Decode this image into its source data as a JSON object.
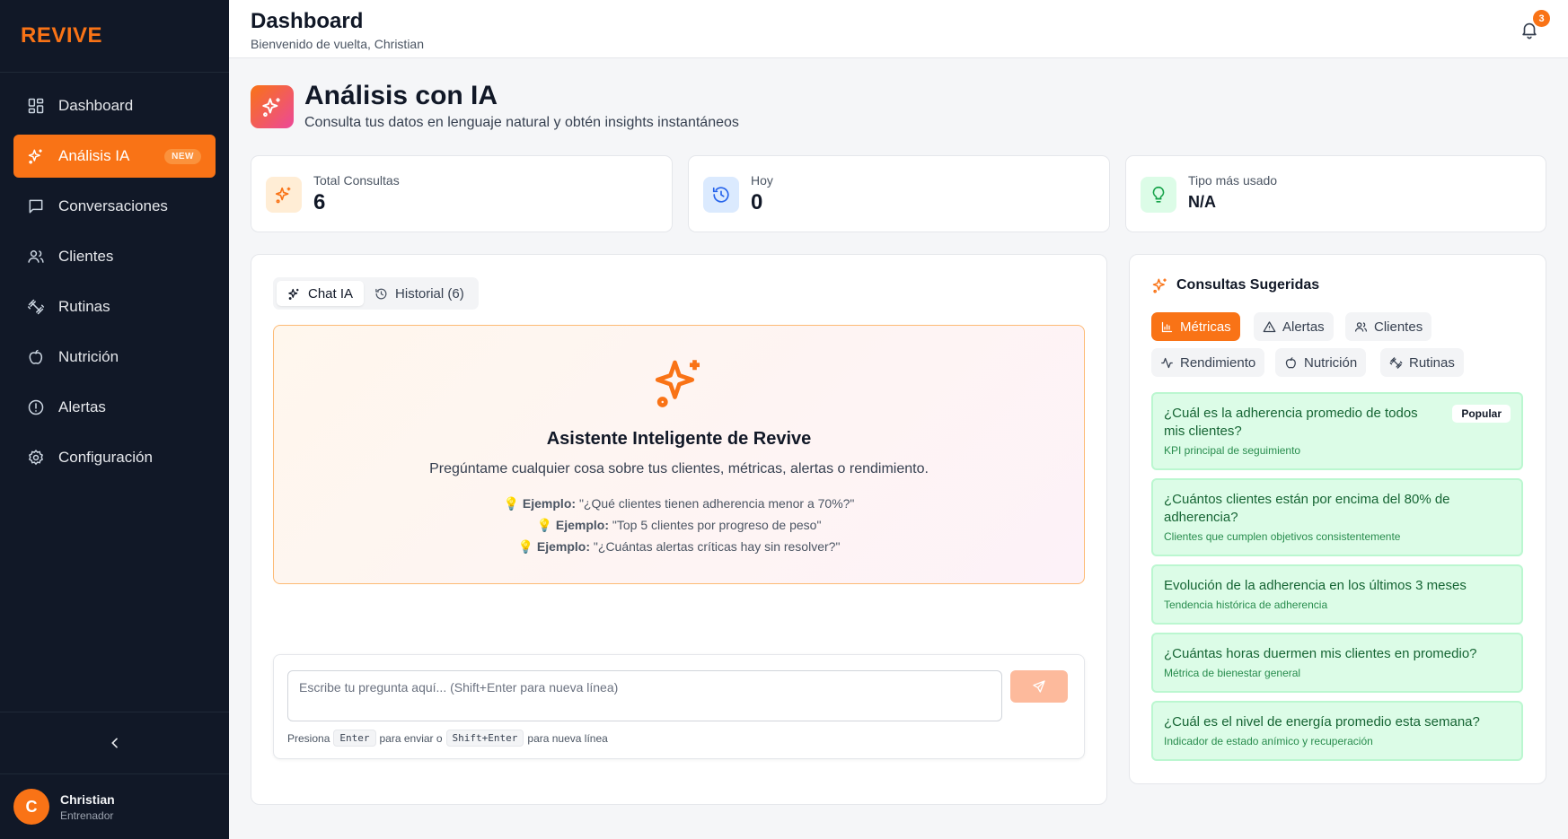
{
  "sidebar": {
    "brand": "REVIVE",
    "items": [
      {
        "label": "Dashboard",
        "icon": "dashboard-icon"
      },
      {
        "label": "Análisis IA",
        "icon": "sparkles-icon",
        "badge": "NEW"
      },
      {
        "label": "Conversaciones",
        "icon": "chat-icon"
      },
      {
        "label": "Clientes",
        "icon": "users-icon"
      },
      {
        "label": "Rutinas",
        "icon": "dumbbell-icon"
      },
      {
        "label": "Nutrición",
        "icon": "apple-icon"
      },
      {
        "label": "Alertas",
        "icon": "alert-circle-icon"
      },
      {
        "label": "Configuración",
        "icon": "gear-icon"
      }
    ],
    "active_index": 1,
    "user": {
      "initial": "C",
      "name": "Christian",
      "role": "Entrenador"
    }
  },
  "header": {
    "title": "Dashboard",
    "subtitle": "Bienvenido de vuelta, Christian",
    "notifications": "3"
  },
  "page": {
    "title": "Análisis con IA",
    "subtitle": "Consulta tus datos en lenguaje natural y obtén insights instantáneos"
  },
  "stats": [
    {
      "label": "Total Consultas",
      "value": "6",
      "color": "#f97316"
    },
    {
      "label": "Hoy",
      "value": "0",
      "color": "#3b82f6"
    },
    {
      "label": "Tipo más usado",
      "value": "N/A",
      "color": "#22c55e"
    }
  ],
  "chat": {
    "tabs": [
      {
        "label": "Chat IA"
      },
      {
        "label": "Historial (6)"
      }
    ],
    "hero": {
      "title": "Asistente Inteligente de Revive",
      "description": "Pregúntame cualquier cosa sobre tus clientes, métricas, alertas o rendimiento.",
      "examples": [
        {
          "prefix": "Ejemplo:",
          "text": "\"¿Qué clientes tienen adherencia menor a 70%?\""
        },
        {
          "prefix": "Ejemplo:",
          "text": "\"Top 5 clientes por progreso de peso\""
        },
        {
          "prefix": "Ejemplo:",
          "text": "\"¿Cuántas alertas críticas hay sin resolver?\""
        }
      ]
    },
    "input_placeholder": "Escribe tu pregunta aquí... (Shift+Enter para nueva línea)",
    "hint": {
      "press": "Presiona",
      "key1": "Enter",
      "mid": "para enviar o",
      "key2": "Shift+Enter",
      "end": "para nueva línea"
    }
  },
  "suggestions": {
    "title": "Consultas Sugeridas",
    "categories": [
      {
        "label": "Métricas",
        "icon": "bar-chart-icon"
      },
      {
        "label": "Alertas",
        "icon": "warning-icon"
      },
      {
        "label": "Clientes",
        "icon": "users-icon"
      },
      {
        "label": "Rendimiento",
        "icon": "activity-icon"
      },
      {
        "label": "Nutrición",
        "icon": "apple-icon"
      },
      {
        "label": "Rutinas",
        "icon": "dumbbell-icon"
      }
    ],
    "active_category": 0,
    "queries": [
      {
        "question": "¿Cuál es la adherencia promedio de todos mis clientes?",
        "description": "KPI principal de seguimiento",
        "badge": "Popular"
      },
      {
        "question": "¿Cuántos clientes están por encima del 80% de adherencia?",
        "description": "Clientes que cumplen objetivos consistentemente"
      },
      {
        "question": "Evolución de la adherencia en los últimos 3 meses",
        "description": "Tendencia histórica de adherencia"
      },
      {
        "question": "¿Cuántas horas duermen mis clientes en promedio?",
        "description": "Métrica de bienestar general"
      },
      {
        "question": "¿Cuál es el nivel de energía promedio esta semana?",
        "description": "Indicador de estado anímico y recuperación"
      }
    ]
  }
}
